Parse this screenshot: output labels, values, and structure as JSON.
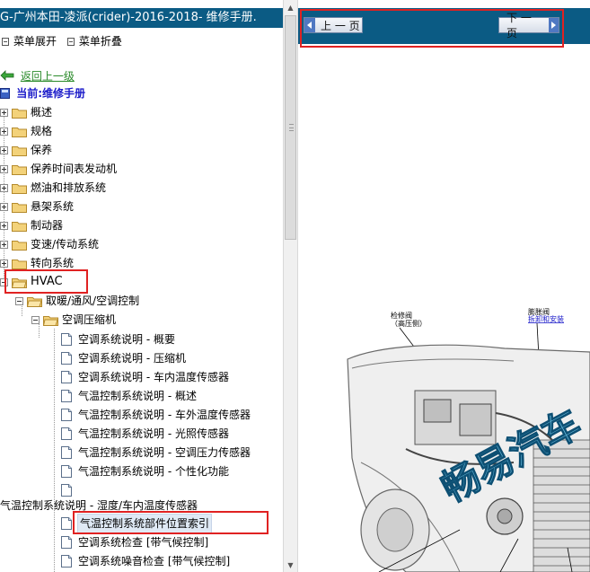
{
  "window": {
    "left_title": "G-广州本田-凌派(crider)-2016-2018- 维修手册."
  },
  "menu": {
    "expand_label": "菜单展开",
    "collapse_label": "菜单折叠"
  },
  "nav": {
    "back_label": "返回上一级",
    "current_label": "当前:维修手册"
  },
  "tree": {
    "top_level": [
      {
        "label": "概述"
      },
      {
        "label": "规格"
      },
      {
        "label": "保养"
      },
      {
        "label": "保养时间表发动机"
      },
      {
        "label": "燃油和排放系统"
      },
      {
        "label": "悬架系统"
      },
      {
        "label": "制动器"
      },
      {
        "label": "变速/传动系统"
      },
      {
        "label": "转向系统"
      },
      {
        "label": "HVAC"
      }
    ],
    "hvac_child": "取暖/通风/空调控制",
    "compressor_folder": "空调压缩机",
    "docs": [
      {
        "label": "空调系统说明 - 概要"
      },
      {
        "label": "空调系统说明 - 压缩机"
      },
      {
        "label": "空调系统说明 - 车内温度传感器"
      },
      {
        "label": "气温控制系统说明 - 概述"
      },
      {
        "label": "气温控制系统说明 - 车外温度传感器"
      },
      {
        "label": "气温控制系统说明 - 光照传感器"
      },
      {
        "label": "气温控制系统说明 - 空调压力传感器"
      },
      {
        "label": "气温控制系统说明 - 个性化功能"
      },
      {
        "label": ""
      }
    ],
    "overflow_label": "气温控制系统说明 - 湿度/车内温度传感器",
    "docs_after": [
      {
        "label": "气温控制系统部件位置索引"
      },
      {
        "label": "空调系统检查 [带气候控制]"
      },
      {
        "label": "空调系统噪音检查 [带气候控制]"
      }
    ]
  },
  "page_nav": {
    "prev_label": "上 一 页",
    "next_label": "下 一 页"
  },
  "diagram": {
    "callout_1_line1": "检修阀",
    "callout_1_line2": "（高压侧）",
    "callout_2_line1": "膨胀阀",
    "callout_2_line2": "拆卸和安装",
    "watermark": "畅易汽车"
  },
  "colors": {
    "title_bar": "#0b5b84",
    "highlight_box": "#e02222",
    "link_green": "#2a8a2a",
    "current_blue": "#1b1bc9"
  }
}
